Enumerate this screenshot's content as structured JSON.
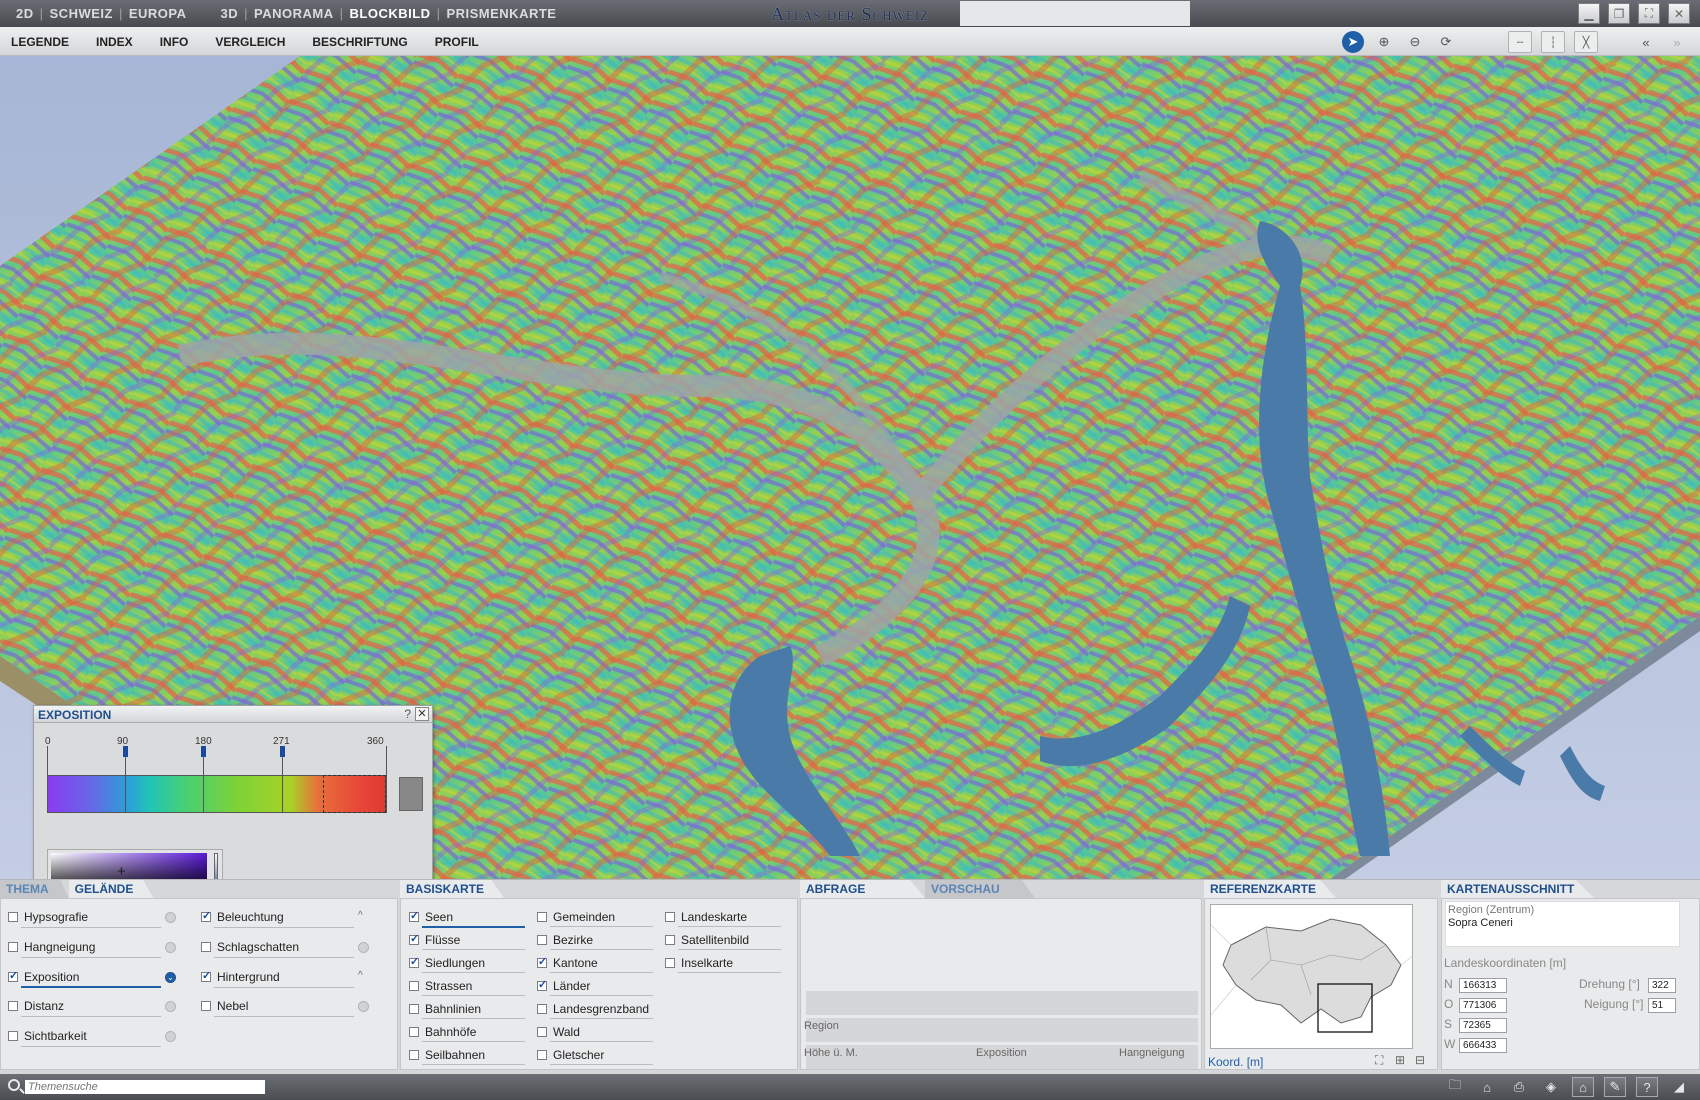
{
  "topbar": {
    "nav_left": [
      "2D",
      "SCHWEIZ",
      "EUROPA"
    ],
    "nav_right": [
      "3D",
      "PANORAMA",
      "BLOCKBILD",
      "PRISMENKARTE"
    ],
    "active": "BLOCKBILD",
    "app_title": "Atlas der Schweiz",
    "window_controls": [
      "minimize-icon",
      "restore-icon",
      "fullscreen-icon",
      "close-icon"
    ]
  },
  "menubar": {
    "items": [
      "LEGENDE",
      "INDEX",
      "INFO",
      "VERGLEICH",
      "BESCHRIFTUNG",
      "PROFIL"
    ],
    "tools": [
      "pointer-icon",
      "zoom-in-icon",
      "zoom-out-icon",
      "rotate-icon",
      "view-horizontal-icon",
      "view-vertical-icon",
      "view-none-icon",
      "collapse-left-icon",
      "collapse-right-icon"
    ],
    "accent_color": "#1f5fa8"
  },
  "exposition": {
    "title": "EXPOSITION",
    "help": "?",
    "close": "✕",
    "ticks": [
      "0",
      "90",
      "180",
      "271",
      "360"
    ],
    "tick_values": [
      0,
      90,
      180,
      271,
      360
    ],
    "gradient_colors": [
      "#8a3cf0",
      "#2aa0d8",
      "#44cf78",
      "#a8d228",
      "#e84838"
    ],
    "selected_range": [
      271,
      360
    ],
    "no_data_color": "#888888"
  },
  "thema": {
    "tabs": [
      "THEMA",
      "GELÄNDE"
    ],
    "active_tab": "GELÄNDE",
    "left": [
      {
        "label": "Hypsografie",
        "checked": false
      },
      {
        "label": "Hangneigung",
        "checked": false
      },
      {
        "label": "Exposition",
        "checked": true
      },
      {
        "label": "Distanz",
        "checked": false
      },
      {
        "label": "Sichtbarkeit",
        "checked": false
      }
    ],
    "right": [
      {
        "label": "Beleuchtung",
        "checked": true
      },
      {
        "label": "Schlagschatten",
        "checked": false
      },
      {
        "label": "Hintergrund",
        "checked": true
      },
      {
        "label": "Nebel",
        "checked": false
      }
    ]
  },
  "basiskarte": {
    "tab": "BASISKARTE",
    "col1": [
      {
        "label": "Seen",
        "checked": true
      },
      {
        "label": "Flüsse",
        "checked": true
      },
      {
        "label": "Siedlungen",
        "checked": true
      },
      {
        "label": "Strassen",
        "checked": false
      },
      {
        "label": "Bahnlinien",
        "checked": false
      },
      {
        "label": "Bahnhöfe",
        "checked": false
      },
      {
        "label": "Seilbahnen",
        "checked": false
      }
    ],
    "col2": [
      {
        "label": "Gemeinden",
        "checked": false
      },
      {
        "label": "Bezirke",
        "checked": false
      },
      {
        "label": "Kantone",
        "checked": true
      },
      {
        "label": "Länder",
        "checked": true
      },
      {
        "label": "Landesgrenzband",
        "checked": false
      },
      {
        "label": "Wald",
        "checked": false
      },
      {
        "label": "Gletscher",
        "checked": false
      }
    ],
    "col3": [
      {
        "label": "Landeskarte",
        "checked": false
      },
      {
        "label": "Satellitenbild",
        "checked": false
      },
      {
        "label": "Inselkarte",
        "checked": false
      }
    ]
  },
  "abfrage": {
    "tabs": [
      "ABFRAGE",
      "VORSCHAU"
    ],
    "region_label": "Region",
    "hoehe_label": "Höhe ü. M.",
    "exposition_label": "Exposition",
    "hangneigung_label": "Hangneigung"
  },
  "referenzkarte": {
    "tab": "REFERENZKARTE",
    "coord_label": "Koord. [m]"
  },
  "kartenausschnitt": {
    "tab": "KARTENAUSSCHNITT",
    "region_label": "Region (Zentrum)",
    "region_value": "Sopra Ceneri",
    "coords_label": "Landeskoordinaten [m]",
    "n_label": "N",
    "n_value": "166313",
    "o_label": "O",
    "o_value": "771306",
    "s_label": "S",
    "s_value": "72365",
    "w_label": "W",
    "w_value": "666433",
    "drehung_label": "Drehung [°]",
    "drehung_value": "322",
    "neigung_label": "Neigung [°]",
    "neigung_value": "51"
  },
  "statusbar": {
    "search_placeholder": "Themensuche",
    "icons": [
      "folder-icon",
      "pin-icon",
      "print-icon",
      "layers-icon",
      "home-icon",
      "tools-icon",
      "help-icon"
    ]
  }
}
